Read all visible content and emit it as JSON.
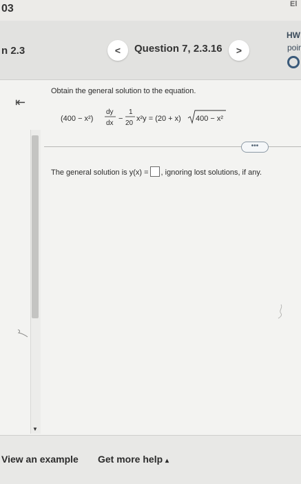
{
  "top": {
    "left_text": "03",
    "right_text": "El"
  },
  "header": {
    "section": "n 2.3",
    "prev_icon": "<",
    "question_title": "Question 7, 2.3.16",
    "next_icon": ">",
    "hw_label": "HW",
    "hw_points": "poir"
  },
  "sidebar": {
    "collapse_icon": "⇤"
  },
  "question": {
    "prompt": "Obtain the general solution to the equation.",
    "equation": {
      "lhs_factor": "(400 − x²)",
      "deriv_num": "dy",
      "deriv_den": "dx",
      "minus": "−",
      "frac_num": "1",
      "frac_den": "20",
      "term": "x²y = (20 + x)",
      "radical": "400 − x²"
    },
    "more_label": "•••",
    "answer_prefix": "The general solution is y(x) =",
    "answer_suffix": ", ignoring lost solutions, if any."
  },
  "footer": {
    "view_example": "View an example",
    "get_help": "Get more help",
    "get_help_arrow": "▴"
  },
  "colors": {
    "background": "#f3f3f1",
    "accent": "#3a5a7a"
  }
}
